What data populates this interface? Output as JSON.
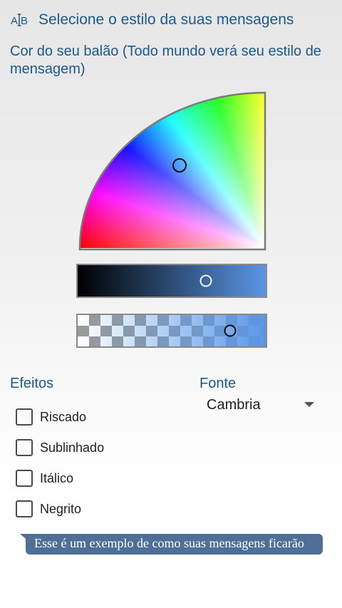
{
  "header": {
    "icon": "text-style-icon",
    "icon_text": "AB",
    "title": "Selecione o estilo da suas mensagens"
  },
  "color_picker": {
    "label": "Cor do seu balão (Todo mundo verá seu estilo de mensagem)",
    "selected_color": "#5a96e6",
    "brightness_gradient": [
      "#000000",
      "#5a96e6"
    ],
    "brightness_level": 0.68,
    "opacity_level": 0.81
  },
  "effects": {
    "title": "Efeitos",
    "options": [
      {
        "label": "Riscado",
        "checked": false
      },
      {
        "label": "Sublinhado",
        "checked": false
      },
      {
        "label": "Itálico",
        "checked": false
      },
      {
        "label": "Negrito",
        "checked": false
      }
    ]
  },
  "font": {
    "title": "Fonte",
    "selected": "Cambria"
  },
  "preview": {
    "text": "Esse é um exemplo de como suas mensagens ficarão",
    "bubble_color": "#4f6f97"
  },
  "colors": {
    "accent": "#1a5a8c"
  }
}
